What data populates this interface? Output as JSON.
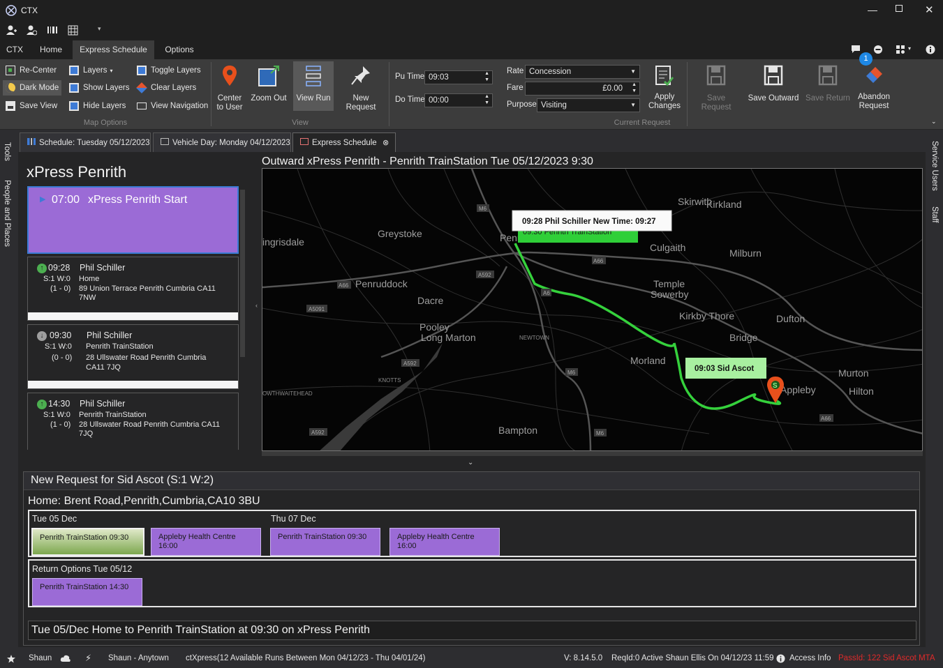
{
  "app": {
    "title": "CTX"
  },
  "menu_tabs": [
    {
      "label": "CTX"
    },
    {
      "label": "Home"
    },
    {
      "label": "Express Schedule"
    },
    {
      "label": "Options"
    }
  ],
  "ribbon": {
    "map_options": {
      "label": "Map Options",
      "recenter": "Re-Center",
      "dark_mode": "Dark Mode",
      "save_view": "Save View",
      "layers": "Layers",
      "show_layers": "Show Layers",
      "hide_layers": "Hide Layers",
      "toggle_layers": "Toggle Layers",
      "clear_layers": "Clear Layers",
      "view_navigation": "View Navigation"
    },
    "view": {
      "label": "View",
      "center_to_user_1": "Center",
      "center_to_user_2": "to User",
      "zoom_out": "Zoom Out",
      "view_run": "View Run",
      "new_request": "New Request"
    },
    "current_request": {
      "label": "Current Request",
      "pu_time_label": "Pu Time",
      "pu_time": "09:03",
      "do_time_label": "Do Time",
      "do_time": "00:00",
      "rate_label": "Rate",
      "rate": "Concession",
      "fare_label": "Fare",
      "fare": "£0.00",
      "purpose_label": "Purpose",
      "purpose": "Visiting",
      "apply_1": "Apply",
      "apply_2": "Changes"
    },
    "save_request": "Save Request",
    "save_outward": "Save Outward",
    "save_return": "Save Return",
    "abandon_1": "Abandon",
    "abandon_2": "Request",
    "notification_count": "1"
  },
  "left_sidebar": {
    "tools": "Tools",
    "people": "People and Places"
  },
  "right_sidebar": {
    "service_users": "Service Users",
    "staff": "Staff"
  },
  "doc_tabs": [
    {
      "label": "Schedule: Tuesday 05/12/2023"
    },
    {
      "label": "Vehicle Day: Monday 04/12/2023"
    },
    {
      "label": "Express Schedule"
    }
  ],
  "run": {
    "title": "xPress Penrith",
    "start": {
      "time": "07:00",
      "label": "xPress Penrith Start"
    },
    "stops": [
      {
        "time": "09:28",
        "name": "Phil Schiller",
        "sw": "S:1 W:0",
        "counts": "(1 - 0)",
        "place": "Home",
        "address1": "89 Union Terrace Penrith Cumbria CA11",
        "address2": "7NW"
      },
      {
        "time": "09:30",
        "name": "Phil Schiller",
        "sw": "S:1 W:0",
        "counts": "(0 - 0)",
        "place": "Penrith TrainStation",
        "address1": "28 Ullswater Road Penrith Cumbria",
        "address2": "CA11 7JQ"
      },
      {
        "time": "14:30",
        "name": "Phil Schiller",
        "sw": "S:1 W:0",
        "counts": "(1 - 0)",
        "place": "Penrith TrainStation",
        "address1": "28 Ullswater Road Penrith Cumbria CA11",
        "address2": "7JQ"
      }
    ]
  },
  "map": {
    "title": "Outward xPress Penrith - Penrith TrainStation Tue 05/12/2023 9:30",
    "tooltip_1": "09:28 Phil Schiller New Time: 09:27",
    "tooltip_1_under": "09:30 Penrith TrainStation",
    "tooltip_2": "09:03 Sid Ascot",
    "pin_letter": "S",
    "places": [
      "Skirwith",
      "Kirkland",
      "Greystoke",
      "ingrisdale",
      "Culgaith",
      "Milburn",
      "Penruddock",
      "Temple",
      "Sowerby",
      "Dacre",
      "Kirkby Thore",
      "Dufton",
      "Pooley",
      "Bridge",
      "Long Marton",
      "Morland",
      "Murton",
      "Hilton",
      "Bampton",
      "Appleby",
      "Penrith"
    ],
    "road_labels": [
      "M6",
      "A66",
      "A592",
      "A6",
      "A5091",
      "A592",
      "M6",
      "A66",
      "A592",
      "M6"
    ],
    "small_labels": [
      "NEWTOWN",
      "KNOTTS",
      "OWTHWAITEHEAD"
    ]
  },
  "request": {
    "title": "New Request for Sid Ascot (S:1 W:2)",
    "home": "Home: Brent Road,Penrith,Cumbria,CA10 3BU",
    "day1": "Tue 05 Dec",
    "day2": "Thu 07 Dec",
    "options": [
      {
        "line1": "Penrith TrainStation 09:30",
        "line2": ""
      },
      {
        "line1": "Appleby Health Centre",
        "line2": "16:00"
      },
      {
        "line1": "Penrith TrainStation 09:30",
        "line2": ""
      },
      {
        "line1": "Appleby Health Centre",
        "line2": "16:00"
      }
    ],
    "return_label": "Return Options Tue 05/12",
    "return_option": "Penrith TrainStation 14:30",
    "summary": "Tue 05/Dec Home to Penrith TrainStation at 09:30 on xPress Penrith"
  },
  "status": {
    "user": "Shaun",
    "anytown": "Shaun - Anytown",
    "ctx": "ctXpress(12 Available Runs Between Mon 04/12/23 - Thu 04/01/24)",
    "version": "V: 8.14.5.0",
    "req": "ReqId:0 Active Shaun Ellis On 04/12/23 11:59",
    "access": "Access Info",
    "pass": "PassId: 122 Sid Ascot MTA"
  },
  "colors": {
    "accent": "#9b6bd6",
    "route": "#35d13c",
    "pin": "#e8501c",
    "warn": "#e02a2a",
    "badge": "#1e88e5"
  }
}
